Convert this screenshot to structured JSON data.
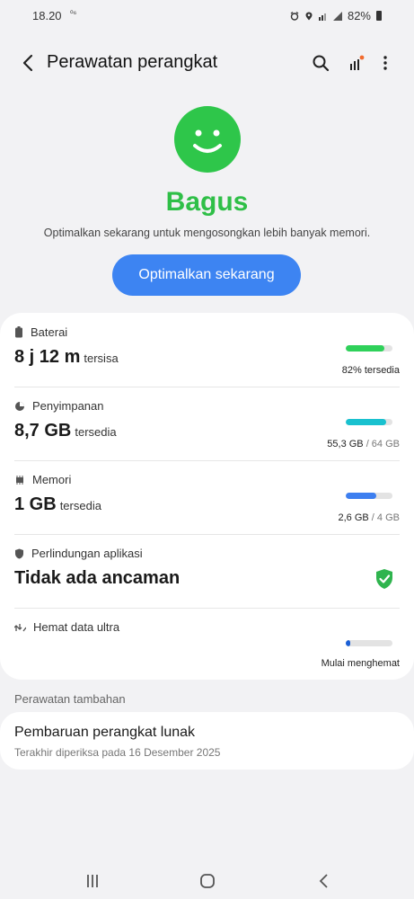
{
  "status_bar": {
    "time": "18.20",
    "extra": "⁰⁶",
    "battery": "82%"
  },
  "header": {
    "title": "Perawatan perangkat"
  },
  "hero": {
    "status": "Bagus",
    "hint": "Optimalkan sekarang untuk mengosongkan lebih banyak memori.",
    "button": "Optimalkan sekarang"
  },
  "items": {
    "battery": {
      "label": "Baterai",
      "value": "8 j 12 m",
      "unit": "tersisa",
      "detail": "82% tersedia",
      "level": 0.82,
      "color": "#2fd15a"
    },
    "storage": {
      "label": "Penyimpanan",
      "value": "8,7 GB",
      "unit": "tersedia",
      "detail_main": "55,3 GB",
      "detail_rest": " / 64 GB",
      "level": 0.86,
      "color": "#19c1cf"
    },
    "memory": {
      "label": "Memori",
      "value": "1 GB",
      "unit": "tersedia",
      "detail_main": "2,6 GB",
      "detail_rest": " / 4 GB",
      "level": 0.65,
      "color": "#3d7ff0"
    },
    "protection": {
      "label": "Perlindungan aplikasi",
      "value": "Tidak ada ancaman"
    },
    "data_saver": {
      "label": "Hemat data ultra",
      "detail": "Mulai menghemat",
      "level": 0.1,
      "color": "#1a5fd6"
    }
  },
  "extra_care": {
    "title": "Perawatan tambahan",
    "update_title": "Pembaruan perangkat lunak",
    "update_sub": "Terakhir diperiksa pada 16 Desember 2025"
  },
  "icons": {
    "back": "chevron-left-icon",
    "search": "search-icon",
    "stats": "signal-bars-icon",
    "menu": "more-vert-icon"
  }
}
